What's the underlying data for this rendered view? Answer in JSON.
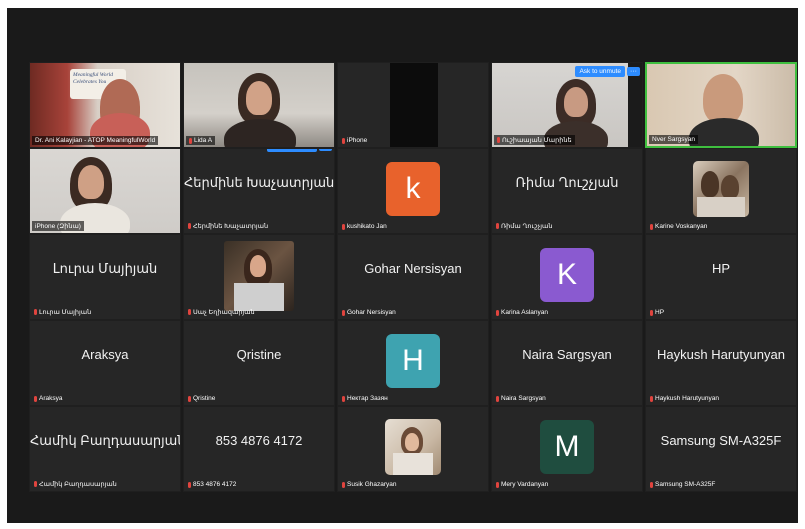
{
  "colors": {
    "window_bg": "#1a1a1a",
    "tile_bg": "#262626",
    "active_speaker_border": "#3fbf3f",
    "ask_button": "#2d8cff",
    "muted_mic": "#e0443e"
  },
  "ask_to_unmute": {
    "label": "Ask to unmute",
    "more": "···"
  },
  "tiles": [
    {
      "label": "Dr. Ani Kalayjian - ATOP MeaningfulWorld",
      "muted": false,
      "type": "video",
      "logo_text": "Meaningful World Celebrates You"
    },
    {
      "label": "Lida A",
      "muted": true,
      "type": "video"
    },
    {
      "label": "iPhone",
      "muted": true,
      "type": "video"
    },
    {
      "label": "Ուշիաայան Մարինե",
      "muted": true,
      "type": "video"
    },
    {
      "label": "Nver Sargsyan",
      "muted": false,
      "type": "video",
      "speaking": true
    },
    {
      "label": "iPhone (Զինա)",
      "muted": false,
      "type": "video"
    },
    {
      "center": "Հերմինե Խաչատրյան",
      "label": "Հերմինե Խաչատրյան",
      "muted": true,
      "type": "name"
    },
    {
      "letter": "k",
      "label": "kushikato Jan",
      "muted": true,
      "type": "letter",
      "color": "#e8622c"
    },
    {
      "center": "Ռիմա Ղուշչյան",
      "label": "Ռիմա Ղուշչյան",
      "muted": true,
      "type": "name"
    },
    {
      "label": "Karine Voskanyan",
      "muted": true,
      "type": "photo"
    },
    {
      "center": "Լուրա Մայիյան",
      "label": "Լուրա Մայիյան",
      "muted": true,
      "type": "name"
    },
    {
      "label": "Սաչ Եղիազարյան",
      "muted": true,
      "type": "photo"
    },
    {
      "center": "Gohar Nersisyan",
      "label": "Gohar Nersisyan",
      "muted": true,
      "type": "name"
    },
    {
      "letter": "K",
      "label": "Karina Aslanyan",
      "muted": true,
      "type": "letter",
      "color": "#8a5ad0"
    },
    {
      "center": "HP",
      "label": "HP",
      "muted": true,
      "type": "name"
    },
    {
      "center": "Araksya",
      "label": "Araksya",
      "muted": true,
      "type": "name"
    },
    {
      "center": "Qristine",
      "label": "Qristine",
      "muted": true,
      "type": "name"
    },
    {
      "letter": "H",
      "label": "Нектар Зазян",
      "muted": true,
      "type": "letter",
      "color": "#3ea3b0"
    },
    {
      "center": "Naira Sargsyan",
      "label": "Naira Sargsyan",
      "muted": true,
      "type": "name"
    },
    {
      "center": "Haykush Harutyunyan",
      "label": "Haykush Harutyunyan",
      "muted": true,
      "type": "name"
    },
    {
      "center": "Համիկ Բաղդասարյան",
      "label": "Համիկ Բաղդասարյան",
      "muted": true,
      "type": "name"
    },
    {
      "center": "853 4876 4172",
      "label": "853 4876 4172",
      "muted": true,
      "type": "name"
    },
    {
      "label": "Susik Ghazaryan",
      "muted": true,
      "type": "photo"
    },
    {
      "letter": "M",
      "label": "Mery Vardanyan",
      "muted": true,
      "type": "letter",
      "color": "#1f4d3f"
    },
    {
      "center": "Samsung SM-A325F",
      "label": "Samsung SM-A325F",
      "muted": true,
      "type": "name"
    }
  ]
}
